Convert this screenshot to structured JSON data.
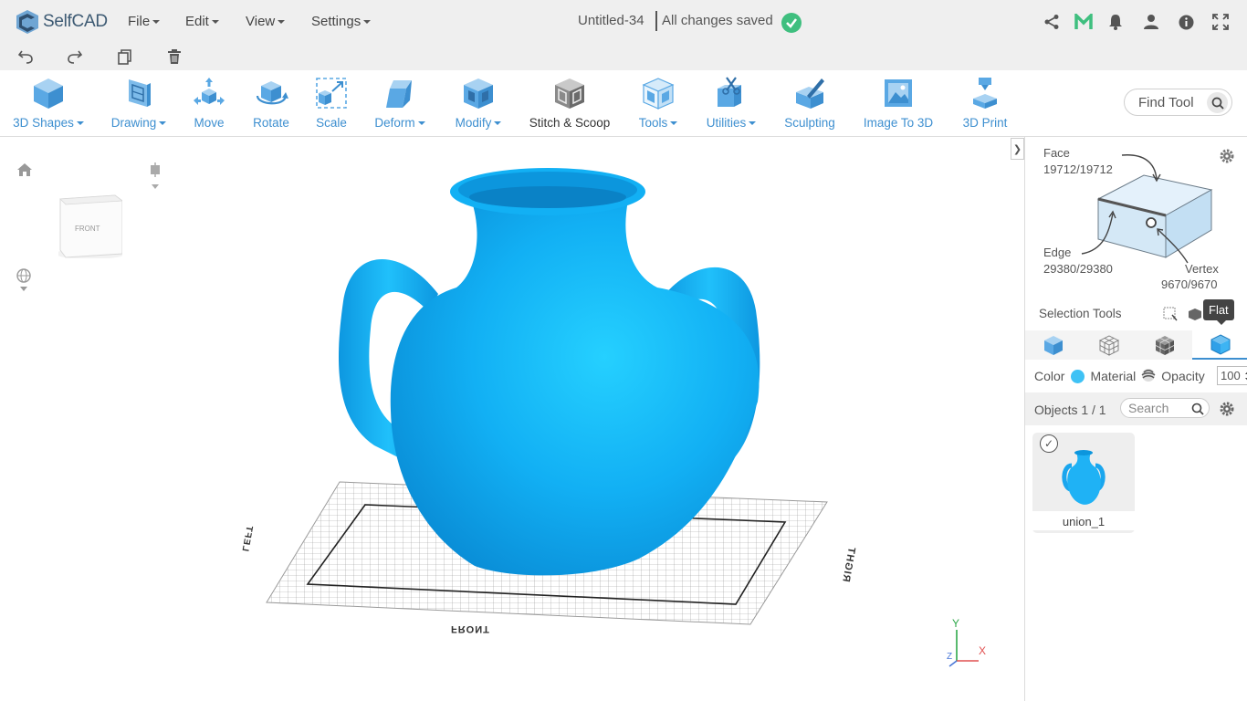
{
  "app": {
    "name": "SelfCAD"
  },
  "menu": {
    "file": "File",
    "edit": "Edit",
    "view": "View",
    "settings": "Settings"
  },
  "document": {
    "title": "Untitled-34",
    "status": "All changes saved"
  },
  "toolbar": {
    "tools": [
      {
        "label": "3D Shapes",
        "icon": "cube-icon"
      },
      {
        "label": "Drawing",
        "icon": "drawing-icon"
      },
      {
        "label": "Move",
        "icon": "move-icon"
      },
      {
        "label": "Rotate",
        "icon": "rotate-icon"
      },
      {
        "label": "Scale",
        "icon": "scale-icon"
      },
      {
        "label": "Deform",
        "icon": "deform-icon"
      },
      {
        "label": "Modify",
        "icon": "modify-icon"
      },
      {
        "label": "Stitch & Scoop",
        "icon": "stitch-scoop-icon"
      },
      {
        "label": "Tools",
        "icon": "tools-icon"
      },
      {
        "label": "Utilities",
        "icon": "utilities-icon"
      },
      {
        "label": "Sculpting",
        "icon": "sculpting-icon"
      },
      {
        "label": "Image To 3D",
        "icon": "image-to-3d-icon"
      },
      {
        "label": "3D Print",
        "icon": "3d-print-icon"
      }
    ],
    "find_tool": "Find Tool"
  },
  "viewport": {
    "cube_face": "FRONT",
    "axis_left": "LEFT",
    "axis_right": "RIGHT",
    "axis_front": "FRONT",
    "gizmo_x": "X",
    "gizmo_y": "Y",
    "gizmo_z": "Z"
  },
  "panel": {
    "face_label": "Face",
    "face_count": "19712/19712",
    "edge_label": "Edge",
    "edge_count": "29380/29380",
    "vertex_label": "Vertex",
    "vertex_count": "9670/9670",
    "selection_tools": "Selection Tools",
    "tooltip": "Flat",
    "color_label": "Color",
    "material_label": "Material",
    "opacity_label": "Opacity",
    "opacity_value": "100",
    "objects_label": "Objects 1 / 1",
    "search_placeholder": "Search",
    "object_name": "union_1"
  },
  "colors": {
    "accent": "#3d8fd0",
    "model": "#1fa9f0",
    "saved": "#3fbf7f"
  }
}
